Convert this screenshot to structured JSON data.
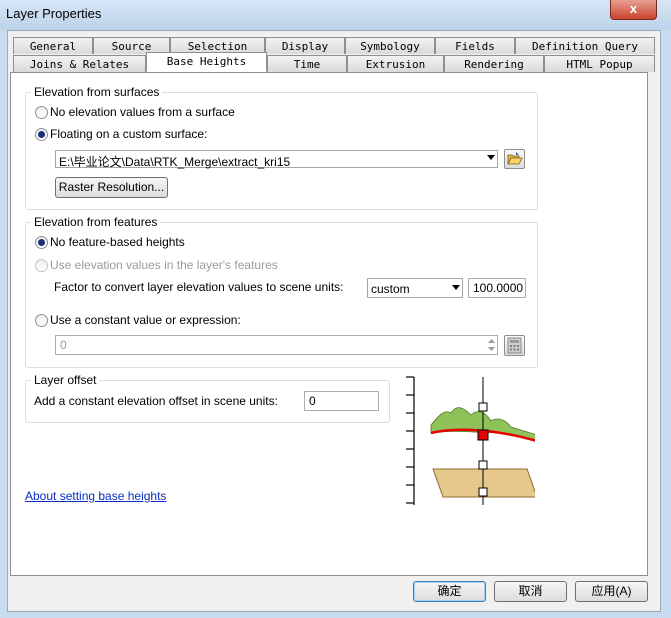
{
  "window": {
    "title": "Layer Properties",
    "close_label": "x"
  },
  "tabs": {
    "row1": [
      "General",
      "Source",
      "Selection",
      "Display",
      "Symbology",
      "Fields",
      "Definition Query"
    ],
    "row2": [
      "Joins & Relates",
      "Base Heights",
      "Time",
      "Extrusion",
      "Rendering",
      "HTML Popup"
    ],
    "active": "Base Heights"
  },
  "surfaces": {
    "legend": "Elevation from surfaces",
    "no_elevation_label": "No elevation values from a surface",
    "floating_label": "Floating on a custom surface:",
    "surface_path": "E:\\毕业论文\\Data\\RTK_Merge\\extract_kri15",
    "raster_button": "Raster Resolution..."
  },
  "features": {
    "legend": "Elevation from features",
    "no_feature_label": "No feature-based heights",
    "use_layer_label": "Use elevation values in the layer's features",
    "factor_label": "Factor to convert layer elevation values to scene units:",
    "factor_unit": "custom",
    "factor_value": "100.0000",
    "constant_label": "Use a constant value or expression:",
    "constant_value": "0"
  },
  "offset": {
    "legend": "Layer offset",
    "label": "Add a constant elevation offset in scene units:",
    "value": "0"
  },
  "link": "About setting base heights",
  "buttons": {
    "ok": "确定",
    "cancel": "取消",
    "apply": "应用(A)"
  },
  "colors": {
    "accent": "#3c7fb1",
    "marker": "#e60000",
    "terrain": "#8fc35a",
    "plane": "#e6c88c"
  }
}
